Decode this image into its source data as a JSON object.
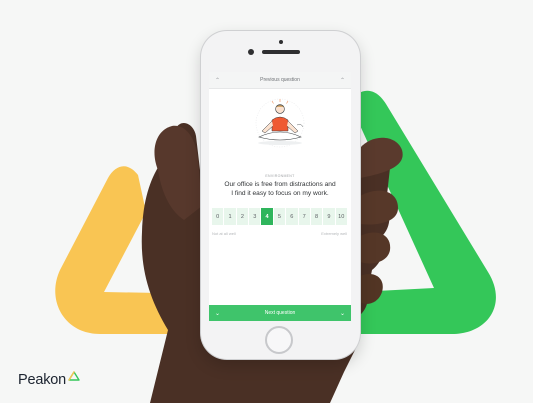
{
  "brand": {
    "name": "Peakon",
    "colors": {
      "green": "#34c759",
      "yellow": "#f9c553",
      "selected": "#2fb55c",
      "next_bar": "#3fc46b"
    }
  },
  "phone_screen": {
    "topbar": {
      "prev_label": "Previous question",
      "left_icon": "chevron-up-icon",
      "right_icon": "chevron-up-icon"
    },
    "category": "ENVIRONMENT",
    "question_line1": "Our office is free from distractions and",
    "question_line2": "I find it easy to focus on my work.",
    "scale": {
      "options": [
        "0",
        "1",
        "2",
        "3",
        "4",
        "5",
        "6",
        "7",
        "8",
        "9",
        "10"
      ],
      "selected": "4",
      "low_label": "Not at all well",
      "high_label": "Extremely well"
    },
    "nextbar": {
      "next_label": "Next question",
      "left_icon": "chevron-down-icon",
      "right_icon": "chevron-down-icon"
    }
  }
}
